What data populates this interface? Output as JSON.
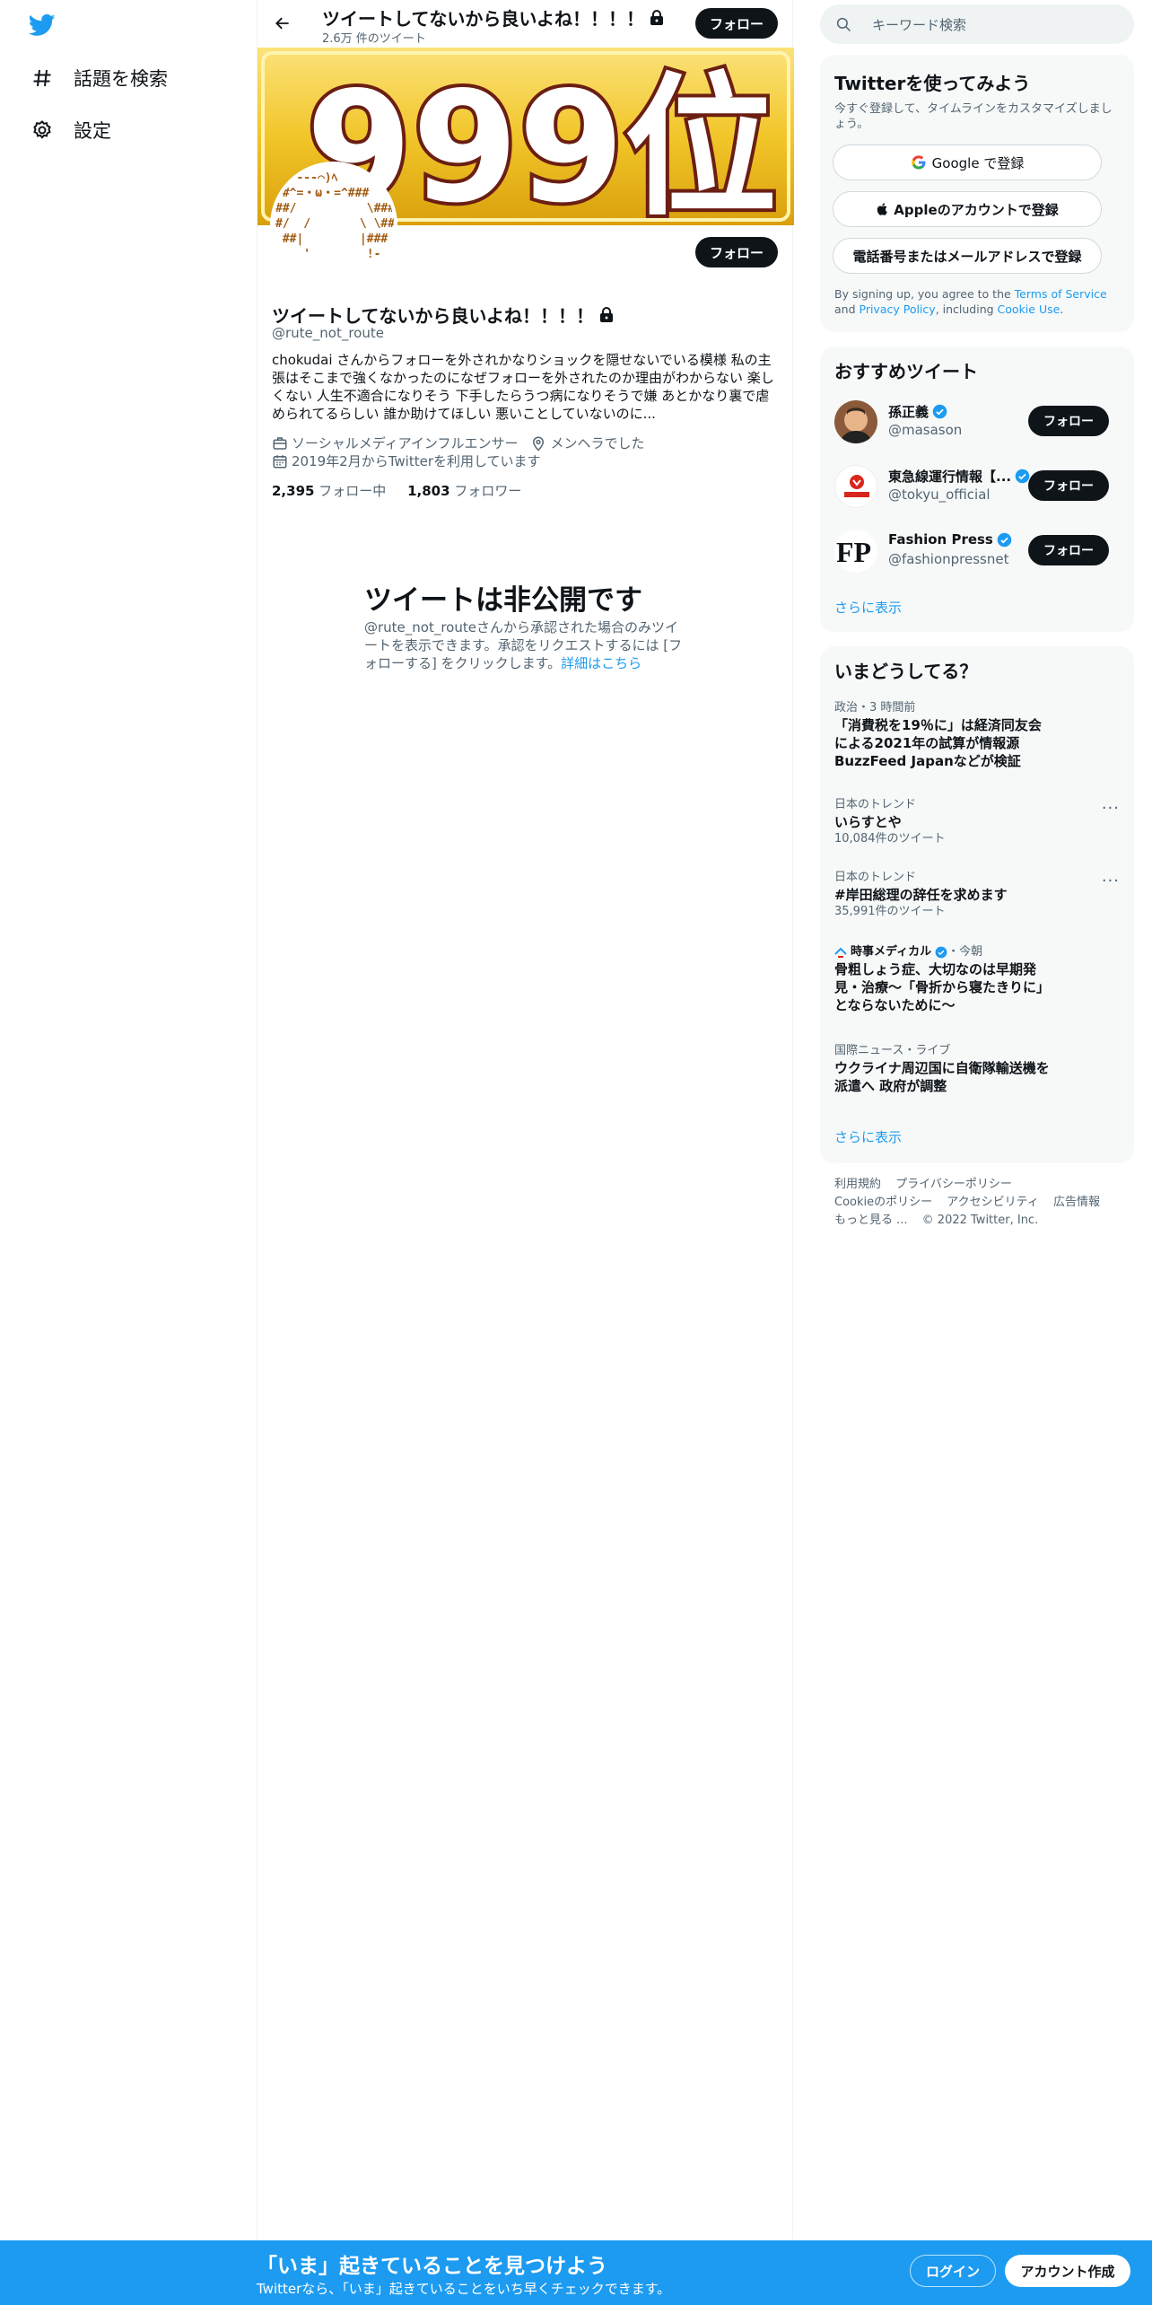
{
  "nav": {
    "explore_label": "話題を検索",
    "settings_label": "設定"
  },
  "header": {
    "title": "ツイートしてないから良いよね！！！！",
    "tweet_count": "2.6万 件のツイート",
    "follow_label": "フォロー"
  },
  "banner": {
    "text": "999位"
  },
  "profile": {
    "name": "ツイートしてないから良いよね！！！！",
    "handle": "@rute_not_route",
    "follow_label": "フォロー",
    "bio": "chokudai さんからフォローを外されかなりショックを隠せないでいる模様 私の主張はそこまで強くなかったのになぜフォローを外されたのか理由がわからない 楽しくない 人生不適合になりそう 下手したらうつ病になりそうで嫌 あとかなり裏で虐められてるらしい 誰か助けてほしい 悪いことしていないのに...",
    "category": "ソーシャルメディアインフルエンサー",
    "location": "メンヘラでした",
    "joined": "2019年2月からTwitterを利用しています",
    "following_count": "2,395",
    "following_label": "フォロー中",
    "followers_count": "1,803",
    "followers_label": "フォロワー",
    "avatar_art": "   ---⌒)ﾍ\n/#^=・ω・=^###\n##/          \\###\n#/  /       \\ \\##\n ##|        |###\n    '        !-"
  },
  "private_notice": {
    "title": "ツイートは非公開です",
    "body": "@rute_not_routeさんから承認された場合のみツイートを表示できます。承認をリクエストするには [フォローする] をクリックします。",
    "link": "詳細はこちら"
  },
  "search": {
    "placeholder": "キーワード検索"
  },
  "signup_card": {
    "title": "Twitterを使ってみよう",
    "subtitle": "今すぐ登録して、タイムラインをカスタマイズしましょう。",
    "google_label": "Google で登録",
    "apple_label": "Appleのアカウントで登録",
    "phone_label": "電話番号またはメールアドレスで登録",
    "terms_prefix": "By signing up, you agree to the ",
    "terms_link": "Terms of Service",
    "terms_and": " and ",
    "privacy_link": "Privacy Policy",
    "terms_including": ", including ",
    "cookie_link": "Cookie Use",
    "terms_end": "."
  },
  "who_to_follow": {
    "title": "おすすめツイート",
    "show_more": "さらに表示",
    "items": [
      {
        "name": "孫正義",
        "handle": "@masason",
        "follow": "フォロー"
      },
      {
        "name": "東急線運行情報【...",
        "handle": "@tokyu_official",
        "follow": "フォロー"
      },
      {
        "name": "Fashion Press",
        "handle": "@fashionpressnet",
        "follow": "フォロー"
      }
    ]
  },
  "trends": {
    "title": "いまどうしてる？",
    "show_more": "さらに表示",
    "items": [
      {
        "category": "政治・3 時間前",
        "title": "「消費税を19％に」は経済同友会による2021年の試算が情報源　BuzzFeed Japanなどが検証"
      },
      {
        "category": "日本のトレンド",
        "title": "いらすとや",
        "count": "10,084件のツイート"
      },
      {
        "category": "日本のトレンド",
        "title": "#岸田総理の辞任を求めます",
        "count": "35,991件のツイート"
      },
      {
        "source": "時事メディカル",
        "time": "・今朝",
        "title": "骨粗しょう症、大切なのは早期発見・治療～「骨折から寝たきりに」とならないために～"
      },
      {
        "category": "国際ニュース・ライブ",
        "title": "ウクライナ周辺国に自衛隊輸送機を派遣へ 政府が調整"
      }
    ]
  },
  "footer": {
    "terms": "利用規約",
    "privacy": "プライバシーポリシー",
    "cookie": "Cookieのポリシー",
    "accessibility": "アクセシビリティ",
    "ads": "広告情報",
    "more": "もっと見る ...",
    "copyright": "© 2022 Twitter, Inc."
  },
  "bottom_bar": {
    "title": "「いま」起きていることを見つけよう",
    "subtitle": "Twitterなら、「いま」起きていることをいち早くチェックできます。",
    "login": "ログイン",
    "signup": "アカウント作成"
  },
  "colors": {
    "brand_blue": "#1d9bf0",
    "text_primary": "#0f1419",
    "text_secondary": "#536471",
    "card_bg": "#f7f9f9",
    "banner_gold": "#f1c21f"
  }
}
